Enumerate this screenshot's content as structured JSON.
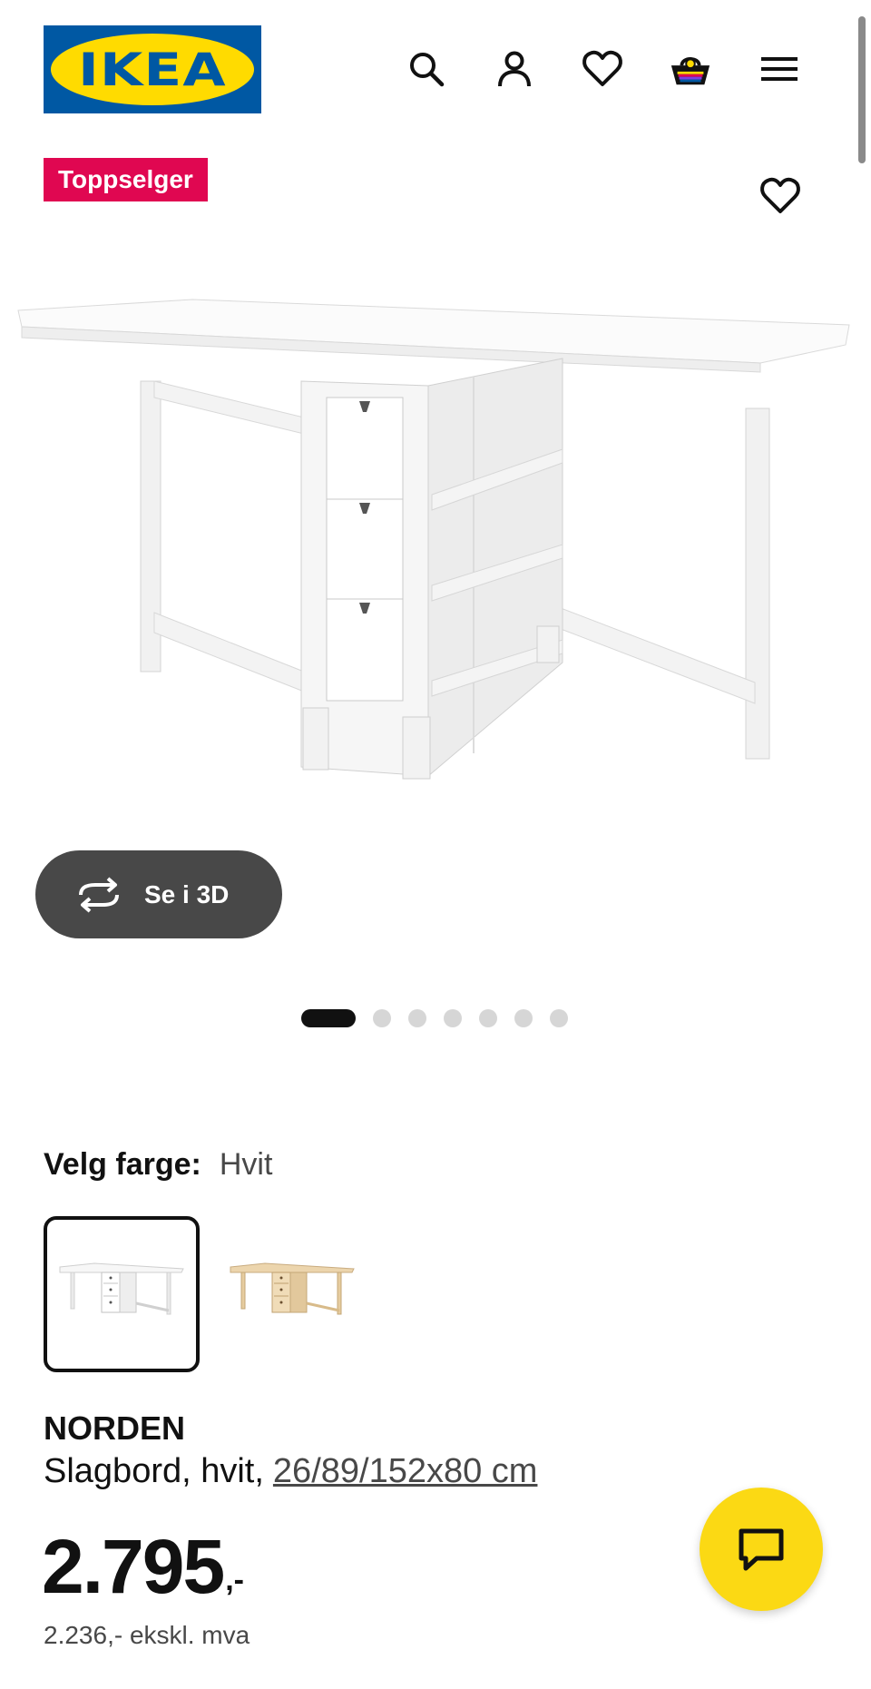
{
  "header": {
    "logo_text": "IKEA",
    "icons": [
      "search-icon",
      "account-icon",
      "favorites-icon",
      "cart-icon",
      "menu-icon"
    ]
  },
  "product": {
    "badge": "Toppselger",
    "view_3d_label": "Se i 3D",
    "image_count": 7,
    "active_image": 1,
    "color_label": "Velg farge:",
    "color_value": "Hvit",
    "name": "NORDEN",
    "description": "Slagbord, hvit,",
    "dimensions": "26/89/152x80 cm",
    "price_main": "2.795",
    "price_suffix": ",-",
    "price_ex_vat": "2.236,- ekskl. mva"
  },
  "colors": {
    "brand_blue": "#0058a3",
    "brand_yellow": "#ffdb00",
    "badge_red": "#e00751",
    "chat_yellow": "#fbd914",
    "button_dark": "#484848"
  }
}
